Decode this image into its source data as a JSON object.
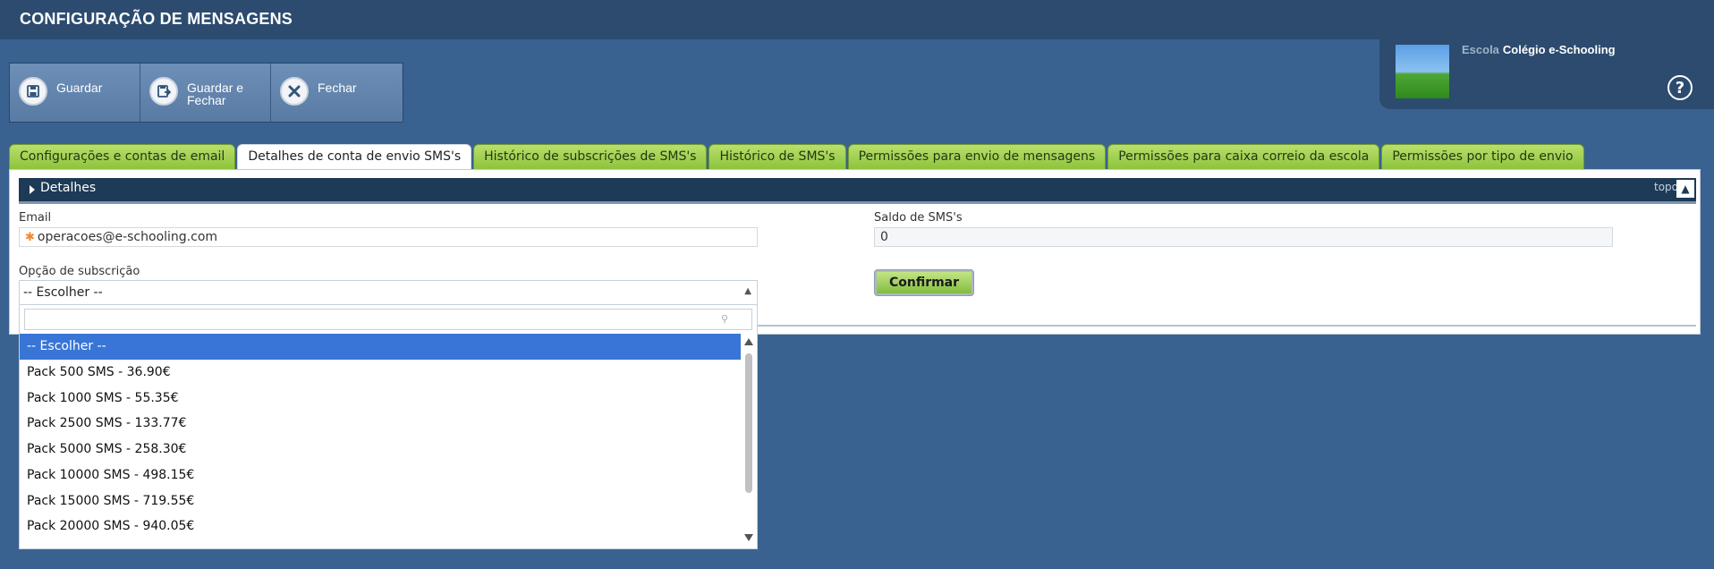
{
  "header": {
    "title": "CONFIGURAÇÃO DE MENSAGENS"
  },
  "toolbar": {
    "buttons": [
      {
        "label": "Guardar",
        "icon": "save-icon"
      },
      {
        "label": "Guardar e Fechar",
        "icon": "save-close-icon"
      },
      {
        "label": "Fechar",
        "icon": "close-icon"
      }
    ]
  },
  "school": {
    "label": "Escola",
    "name": "Colégio e-Schooling",
    "help": "?"
  },
  "tabs": [
    {
      "label": "Configurações e contas de email",
      "active": false
    },
    {
      "label": "Detalhes de conta de envio SMS's",
      "active": true
    },
    {
      "label": "Histórico de subscrições de SMS's",
      "active": false
    },
    {
      "label": "Histórico de SMS's",
      "active": false
    },
    {
      "label": "Permissões para envio de mensagens",
      "active": false
    },
    {
      "label": "Permissões para caixa correio da escola",
      "active": false
    },
    {
      "label": "Permissões por tipo de envio",
      "active": false
    }
  ],
  "section": {
    "title": "Detalhes",
    "topo": "topo"
  },
  "form": {
    "email_label": "Email",
    "email_value": "operacoes@e-schooling.com",
    "saldo_label": "Saldo de SMS's",
    "saldo_value": "0",
    "subscription_label": "Opção de subscrição",
    "subscription_selected": "-- Escolher --",
    "confirm_label": "Confirmar"
  },
  "dropdown": {
    "options": [
      "-- Escolher --",
      "Pack 500 SMS - 36.90€",
      "Pack 1000 SMS - 55.35€",
      "Pack 2500 SMS - 133.77€",
      "Pack 5000 SMS - 258.30€",
      "Pack 10000 SMS - 498.15€",
      "Pack 15000 SMS - 719.55€",
      "Pack 20000 SMS - 940.05€"
    ],
    "selected_index": 0
  },
  "colors": {
    "background": "#3a6290",
    "header": "#2c4b6f",
    "tab_green": "#9ccf4c",
    "selected": "#3875d7"
  }
}
